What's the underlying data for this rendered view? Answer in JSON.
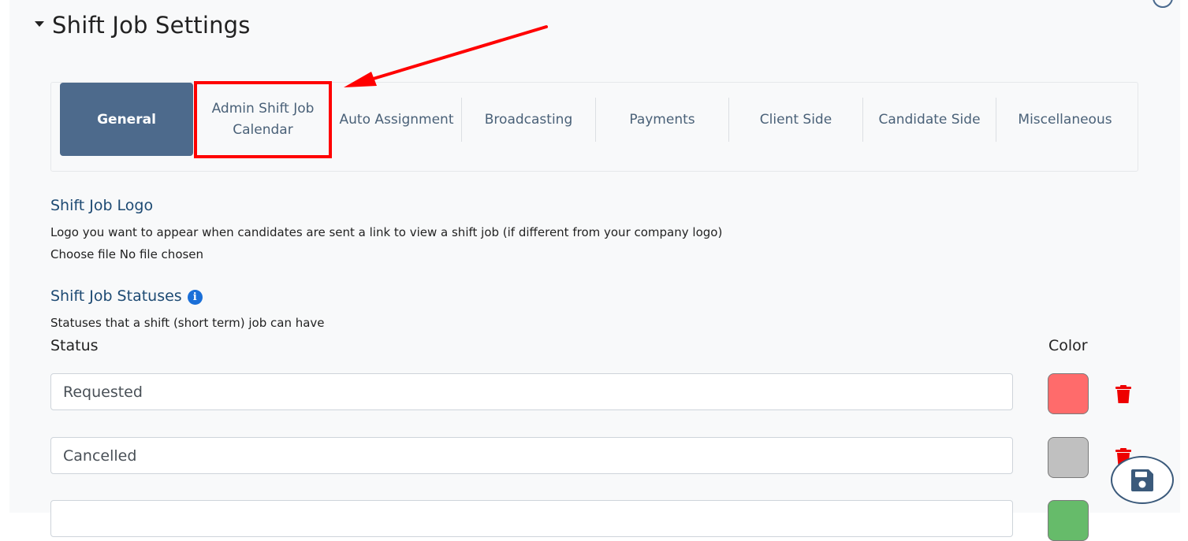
{
  "section": {
    "title": "Shift Job Settings"
  },
  "tabs": [
    {
      "label": "General",
      "active": true
    },
    {
      "label": "Admin Shift Job Calendar",
      "line1": "Admin Shift Job",
      "line2": "Calendar",
      "highlighted": true
    },
    {
      "label": "Auto Assignment"
    },
    {
      "label": "Broadcasting"
    },
    {
      "label": "Payments"
    },
    {
      "label": "Client Side"
    },
    {
      "label": "Candidate Side"
    },
    {
      "label": "Miscellaneous"
    }
  ],
  "logo_section": {
    "title": "Shift Job Logo",
    "description": "Logo you want to appear when candidates are sent a link to view a shift job (if different from your company logo)",
    "file_button": "Choose file",
    "file_status": "No file chosen"
  },
  "statuses_section": {
    "title": "Shift Job Statuses",
    "info_icon": "info-icon",
    "description": "Statuses that a shift (short term) job can have",
    "col_status": "Status",
    "col_color": "Color",
    "rows": [
      {
        "value": "Requested",
        "color": "#ff6b6b"
      },
      {
        "value": "Cancelled",
        "color": "#c0c0c0"
      },
      {
        "value": "",
        "color": "#66bb6a"
      }
    ]
  },
  "colors": {
    "accent": "#4d6a8c",
    "heading": "#1d4a73",
    "delete": "#ee0000",
    "highlight": "#ff0000"
  }
}
